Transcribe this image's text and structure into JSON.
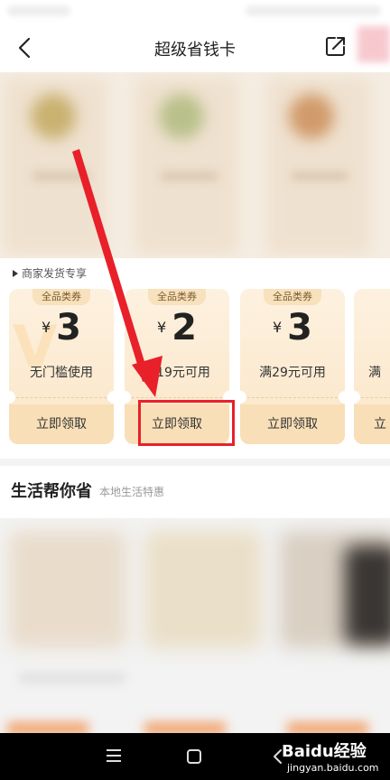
{
  "header": {
    "title": "超级省钱卡"
  },
  "coupon_section": {
    "tag": "商家发货专享",
    "coupons": [
      {
        "label": "全品类券",
        "currency": "¥",
        "amount": "3",
        "condition": "无门槛使用",
        "button": "立即领取"
      },
      {
        "label": "全品类券",
        "currency": "¥",
        "amount": "2",
        "condition": "满19元可用",
        "button": "立即领取"
      },
      {
        "label": "全品类券",
        "currency": "¥",
        "amount": "3",
        "condition": "满29元可用",
        "button": "立即领取"
      },
      {
        "label": "",
        "currency": "",
        "amount": "",
        "condition": "满",
        "button": "立"
      }
    ]
  },
  "life_section": {
    "title": "生活帮你省",
    "subtitle": "本地生活特惠"
  },
  "watermark": {
    "brand": "Baidu经验",
    "url": "jingyan.baidu.com"
  },
  "colors": {
    "highlight_box": "#e8202a",
    "arrow": "#e8202a",
    "coupon_bg": "#fbe6c8"
  }
}
